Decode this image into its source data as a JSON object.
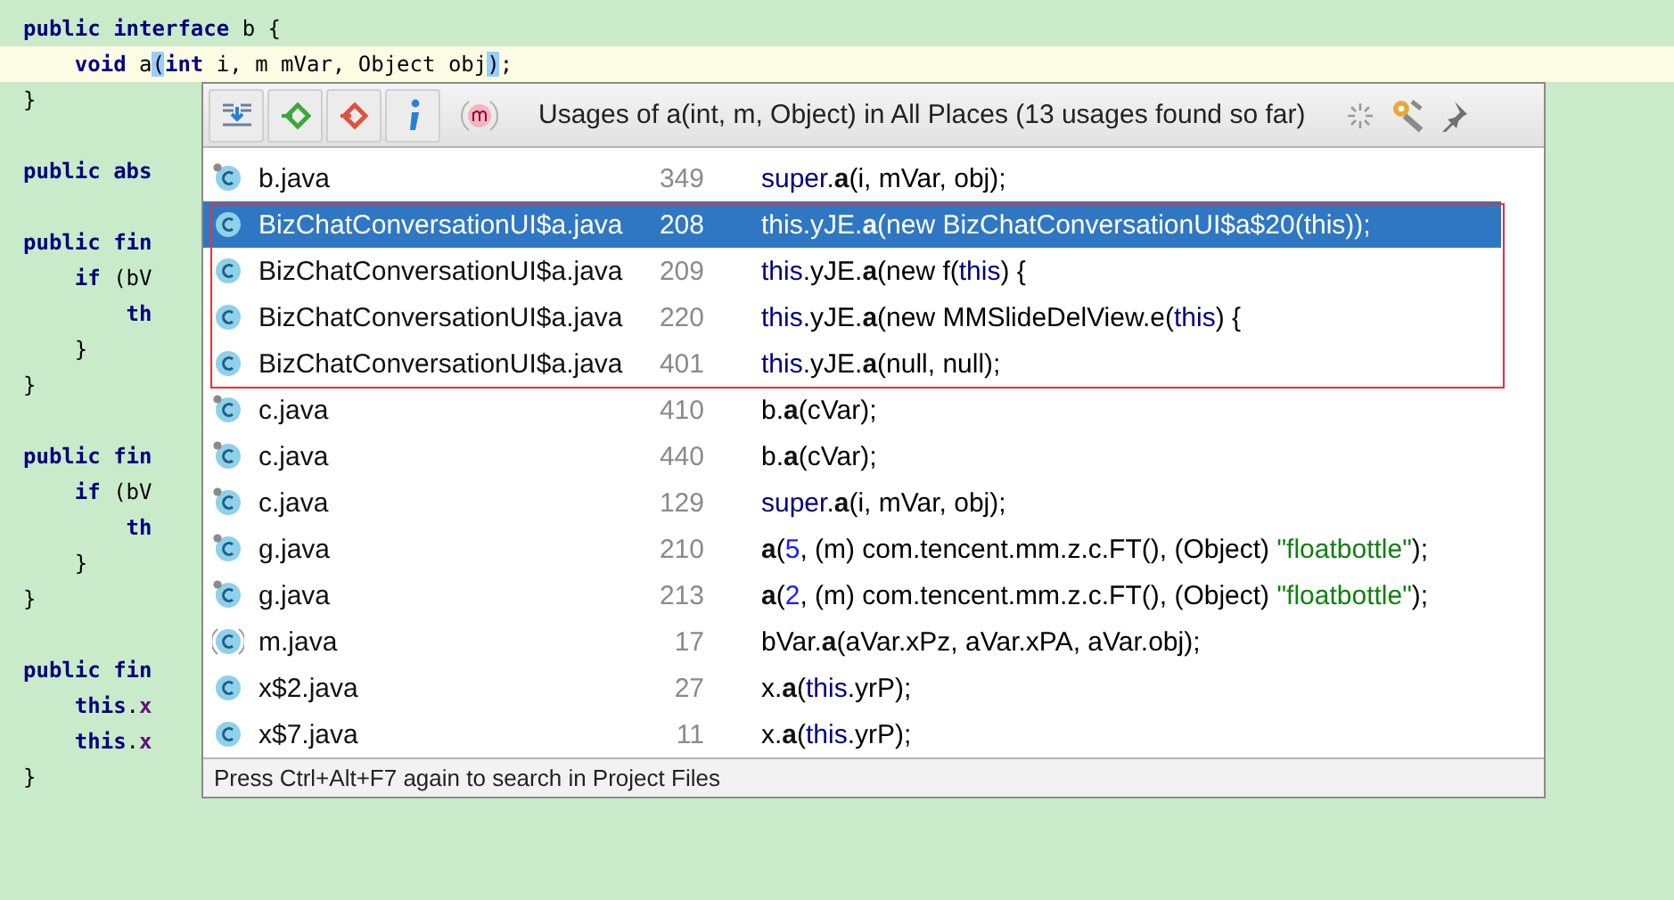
{
  "editor": {
    "lines": [
      {
        "kind": "code",
        "current": false,
        "tokens": [
          {
            "text": "public interface",
            "kind": "kw"
          },
          {
            "text": " b {",
            "kind": "p"
          }
        ]
      },
      {
        "kind": "code",
        "current": true,
        "tokens": [
          {
            "text": "    void",
            "kind": "kw"
          },
          {
            "text": " a",
            "kind": "p"
          },
          {
            "text": "(",
            "kind": "brace"
          },
          {
            "text": "int",
            "kind": "kw"
          },
          {
            "text": " i, m mVar, Object obj",
            "kind": "p"
          },
          {
            "text": ")",
            "kind": "brace"
          },
          {
            "text": ";",
            "kind": "p"
          }
        ]
      },
      {
        "kind": "code",
        "current": false,
        "tokens": [
          {
            "text": "}",
            "kind": "p"
          }
        ]
      },
      {
        "kind": "blank",
        "current": false
      },
      {
        "kind": "code",
        "current": false,
        "tokens": [
          {
            "text": "public abs",
            "kind": "kw"
          }
        ]
      },
      {
        "kind": "blank",
        "current": false
      },
      {
        "kind": "code",
        "current": false,
        "tokens": [
          {
            "text": "public fin",
            "kind": "kw"
          }
        ]
      },
      {
        "kind": "code",
        "current": false,
        "tokens": [
          {
            "text": "    if",
            "kind": "kw"
          },
          {
            "text": " (bV",
            "kind": "p"
          }
        ]
      },
      {
        "kind": "code",
        "current": false,
        "tokens": [
          {
            "text": "        th",
            "kind": "kw"
          }
        ]
      },
      {
        "kind": "code",
        "current": false,
        "tokens": [
          {
            "text": "    }",
            "kind": "p"
          }
        ]
      },
      {
        "kind": "code",
        "current": false,
        "tokens": [
          {
            "text": "}",
            "kind": "p"
          }
        ]
      },
      {
        "kind": "blank",
        "current": false
      },
      {
        "kind": "code",
        "current": false,
        "tokens": [
          {
            "text": "public fin",
            "kind": "kw"
          }
        ]
      },
      {
        "kind": "code",
        "current": false,
        "tokens": [
          {
            "text": "    if",
            "kind": "kw"
          },
          {
            "text": " (bV",
            "kind": "p"
          }
        ]
      },
      {
        "kind": "code",
        "current": false,
        "tokens": [
          {
            "text": "        th",
            "kind": "kw"
          }
        ]
      },
      {
        "kind": "code",
        "current": false,
        "tokens": [
          {
            "text": "    }",
            "kind": "p"
          }
        ]
      },
      {
        "kind": "code",
        "current": false,
        "tokens": [
          {
            "text": "}",
            "kind": "p"
          }
        ]
      },
      {
        "kind": "blank",
        "current": false
      },
      {
        "kind": "code",
        "current": false,
        "tokens": [
          {
            "text": "public fin",
            "kind": "kw"
          }
        ]
      },
      {
        "kind": "code",
        "current": false,
        "tokens": [
          {
            "text": "    this",
            "kind": "kw"
          },
          {
            "text": ".",
            "kind": "p"
          },
          {
            "text": "x",
            "kind": "field"
          }
        ]
      },
      {
        "kind": "code",
        "current": false,
        "tokens": [
          {
            "text": "    this",
            "kind": "kw"
          },
          {
            "text": ".",
            "kind": "p"
          },
          {
            "text": "x",
            "kind": "field"
          }
        ]
      },
      {
        "kind": "code",
        "current": false,
        "tokens": [
          {
            "text": "}",
            "kind": "p"
          }
        ]
      }
    ]
  },
  "popup": {
    "title": "Usages of a(int, m, Object) in All Places (13 usages found so far)",
    "rows": [
      {
        "file": "b.java",
        "line": "349",
        "kind": "class_marked",
        "selected": false,
        "marked": false,
        "code": [
          {
            "text": "super",
            "kind": "kw"
          },
          {
            "text": ".",
            "kind": "p"
          },
          {
            "text": "a",
            "kind": "m"
          },
          {
            "text": "(i, mVar, obj);",
            "kind": "p"
          }
        ]
      },
      {
        "file": "BizChatConversationUI$a.java",
        "line": "208",
        "kind": "class",
        "selected": true,
        "marked": true,
        "code": [
          {
            "text": "this",
            "kind": "kw"
          },
          {
            "text": ".yJE.",
            "kind": "p"
          },
          {
            "text": "a",
            "kind": "m"
          },
          {
            "text": "(new BizChatConversationUI$a$20(",
            "kind": "p"
          },
          {
            "text": "this",
            "kind": "kw"
          },
          {
            "text": "));",
            "kind": "p"
          }
        ]
      },
      {
        "file": "BizChatConversationUI$a.java",
        "line": "209",
        "kind": "class",
        "selected": false,
        "marked": true,
        "code": [
          {
            "text": "this",
            "kind": "kw"
          },
          {
            "text": ".yJE.",
            "kind": "p"
          },
          {
            "text": "a",
            "kind": "m"
          },
          {
            "text": "(new f(",
            "kind": "p"
          },
          {
            "text": "this",
            "kind": "kw"
          },
          {
            "text": ") {",
            "kind": "p"
          }
        ]
      },
      {
        "file": "BizChatConversationUI$a.java",
        "line": "220",
        "kind": "class",
        "selected": false,
        "marked": true,
        "code": [
          {
            "text": "this",
            "kind": "kw"
          },
          {
            "text": ".yJE.",
            "kind": "p"
          },
          {
            "text": "a",
            "kind": "m"
          },
          {
            "text": "(new MMSlideDelView.e(",
            "kind": "p"
          },
          {
            "text": "this",
            "kind": "kw"
          },
          {
            "text": ") {",
            "kind": "p"
          }
        ]
      },
      {
        "file": "BizChatConversationUI$a.java",
        "line": "401",
        "kind": "class",
        "selected": false,
        "marked": true,
        "code": [
          {
            "text": "this",
            "kind": "kw"
          },
          {
            "text": ".yJE.",
            "kind": "p"
          },
          {
            "text": "a",
            "kind": "m"
          },
          {
            "text": "(null, null);",
            "kind": "p"
          }
        ]
      },
      {
        "file": "c.java",
        "line": "410",
        "kind": "class_marked",
        "selected": false,
        "marked": false,
        "code": [
          {
            "text": "b.",
            "kind": "p"
          },
          {
            "text": "a",
            "kind": "m"
          },
          {
            "text": "(cVar);",
            "kind": "p"
          }
        ]
      },
      {
        "file": "c.java",
        "line": "440",
        "kind": "class_marked",
        "selected": false,
        "marked": false,
        "code": [
          {
            "text": "b.",
            "kind": "p"
          },
          {
            "text": "a",
            "kind": "m"
          },
          {
            "text": "(cVar);",
            "kind": "p"
          }
        ]
      },
      {
        "file": "c.java",
        "line": "129",
        "kind": "class_marked",
        "selected": false,
        "marked": false,
        "code": [
          {
            "text": "super",
            "kind": "kw"
          },
          {
            "text": ".",
            "kind": "p"
          },
          {
            "text": "a",
            "kind": "m"
          },
          {
            "text": "(i, mVar, obj);",
            "kind": "p"
          }
        ]
      },
      {
        "file": "g.java",
        "line": "210",
        "kind": "class_marked",
        "selected": false,
        "marked": false,
        "code": [
          {
            "text": "a",
            "kind": "m"
          },
          {
            "text": "(",
            "kind": "p"
          },
          {
            "text": "5",
            "kind": "num"
          },
          {
            "text": ", (m) com.tencent.mm.z.c.FT(), (Object) ",
            "kind": "p"
          },
          {
            "text": "\"floatbottle\"",
            "kind": "str"
          },
          {
            "text": ");",
            "kind": "p"
          }
        ]
      },
      {
        "file": "g.java",
        "line": "213",
        "kind": "class_marked",
        "selected": false,
        "marked": false,
        "code": [
          {
            "text": "a",
            "kind": "m"
          },
          {
            "text": "(",
            "kind": "p"
          },
          {
            "text": "2",
            "kind": "num"
          },
          {
            "text": ", (m) com.tencent.mm.z.c.FT(), (Object) ",
            "kind": "p"
          },
          {
            "text": "\"floatbottle\"",
            "kind": "str"
          },
          {
            "text": ");",
            "kind": "p"
          }
        ]
      },
      {
        "file": "m.java",
        "line": "17",
        "kind": "abstract",
        "selected": false,
        "marked": false,
        "code": [
          {
            "text": "bVar.",
            "kind": "p"
          },
          {
            "text": "a",
            "kind": "m"
          },
          {
            "text": "(aVar.xPz, aVar.xPA, aVar.obj);",
            "kind": "p"
          }
        ]
      },
      {
        "file": "x$2.java",
        "line": "27",
        "kind": "class",
        "selected": false,
        "marked": false,
        "code": [
          {
            "text": "x.",
            "kind": "p"
          },
          {
            "text": "a",
            "kind": "m"
          },
          {
            "text": "(",
            "kind": "p"
          },
          {
            "text": "this",
            "kind": "kw"
          },
          {
            "text": ".yrP);",
            "kind": "p"
          }
        ]
      },
      {
        "file": "x$7.java",
        "line": "11",
        "kind": "class",
        "selected": false,
        "marked": false,
        "code": [
          {
            "text": "x.",
            "kind": "p"
          },
          {
            "text": "a",
            "kind": "m"
          },
          {
            "text": "(",
            "kind": "p"
          },
          {
            "text": "this",
            "kind": "kw"
          },
          {
            "text": ".yrP);",
            "kind": "p"
          }
        ]
      }
    ],
    "footer": "Press Ctrl+Alt+F7 again to search in Project Files"
  }
}
